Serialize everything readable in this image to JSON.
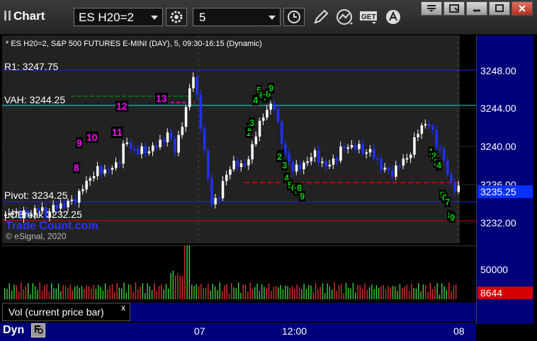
{
  "window": {
    "title": "Chart",
    "symbol": "ES H20=2",
    "interval": "5"
  },
  "chart": {
    "header": "* ES H20=2, S&P 500 FUTURES E-MINI (DAY), 5, 09:30-16:15 (Dynamic)",
    "watermark": "© eSignal, 2020",
    "watermark2": "Trade Count.com",
    "levels": {
      "r1": "R1: 3247.75",
      "vah": "VAH: 3244.25",
      "pivot": "Pivot: 3234.25",
      "other": "LOBreak 3232.25"
    },
    "price_ticks": [
      "3248.00",
      "3244.00",
      "3240.00",
      "3236.00",
      "3232.00"
    ],
    "last_price": "3235.25",
    "sequence_labels_magenta": [
      "8",
      "9",
      "10",
      "11",
      "12",
      "13"
    ],
    "sequence_labels_green": [
      "1",
      "2",
      "3",
      "4",
      "5",
      "6",
      "7",
      "8",
      "9",
      "1",
      "2",
      "3",
      "4",
      "5",
      "6",
      "7",
      "8",
      "9",
      "1",
      "2",
      "3",
      "4",
      "5",
      "6",
      "7",
      "8",
      "9"
    ]
  },
  "volume": {
    "tick": "50000",
    "current": "8644",
    "label": "Vol (current price bar)",
    "close": "x"
  },
  "time_axis": {
    "labels": [
      "07",
      "12:00",
      "08"
    ]
  },
  "footer": {
    "dyn": "Dyn"
  },
  "colors": {
    "axis_bg": "#00007a",
    "price_box": "#0a32ff",
    "volume_box": "#d40000",
    "up_candle": "#ffffff",
    "down_candle": "#2030ff"
  }
}
